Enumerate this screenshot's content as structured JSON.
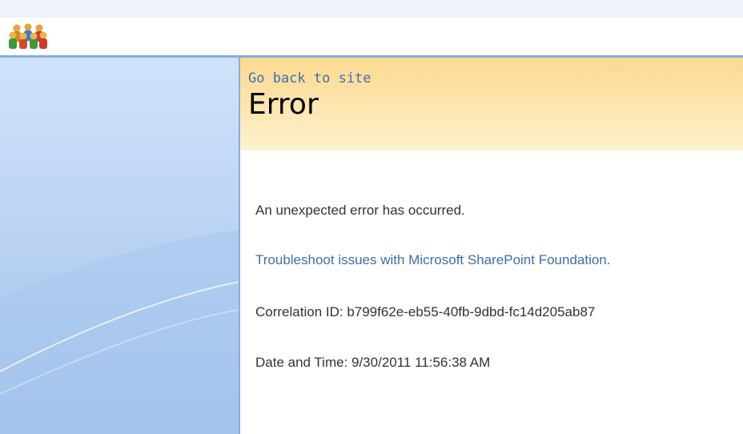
{
  "header": {
    "logo_icon": "sharepoint-people-logo-icon"
  },
  "title_area": {
    "back_link": "Go back to site",
    "title": "Error"
  },
  "content": {
    "message": "An unexpected error has occurred.",
    "troubleshoot_link": "Troubleshoot issues with Microsoft SharePoint Foundation.",
    "correlation": "Correlation ID: b799f62e-eb55-40fb-9dbd-fc14d205ab87",
    "datetime": "Date and Time: 9/30/2011 11:56:38 AM"
  },
  "colors": {
    "link": "#3b6db4",
    "title_band": "#fde7b3",
    "nav_blue": "#bcd4f3",
    "header_border": "#7fb0e0"
  }
}
